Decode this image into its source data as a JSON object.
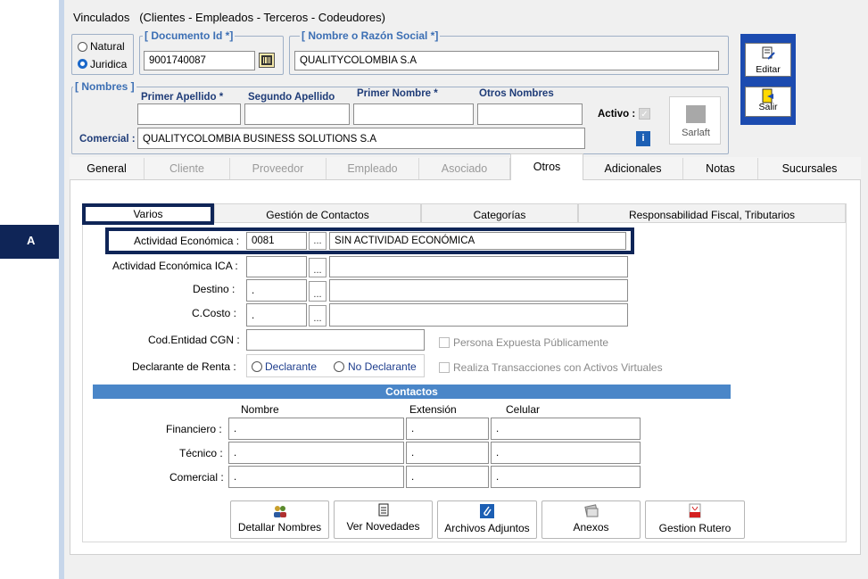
{
  "window": {
    "title": "Vinculados   (Clientes - Empleados - Terceros - Codeudores)"
  },
  "persona": {
    "natural_label": "Natural",
    "juridica_label": "Juridica",
    "selected": "Juridica"
  },
  "documento": {
    "legend": "[ Documento Id *]",
    "value": "9001740087"
  },
  "razon_social": {
    "legend": "[ Nombre o Razón Social *]",
    "value": "QUALITYCOLOMBIA S.A"
  },
  "nombres": {
    "legend": "[ Nombres ]",
    "primer_apellido": "Primer Apellido *",
    "segundo_apellido": "Segundo Apellido",
    "primer_nombre": "Primer Nombre *",
    "otros_nombres": "Otros Nombres",
    "activo_label": "Activo :",
    "comercial_label": "Comercial :",
    "comercial_value": "QUALITYCOLOMBIA BUSINESS SOLUTIONS S.A",
    "sarlaft_label": "Sarlaft"
  },
  "side_buttons": {
    "editar": "Editar",
    "salir": "Salir"
  },
  "tabs": [
    {
      "label": "General",
      "disabled": false
    },
    {
      "label": "Cliente",
      "disabled": true
    },
    {
      "label": "Proveedor",
      "disabled": true
    },
    {
      "label": "Empleado",
      "disabled": true
    },
    {
      "label": "Asociado",
      "disabled": true
    },
    {
      "label": "Otros",
      "disabled": false
    },
    {
      "label": "Adicionales",
      "disabled": false
    },
    {
      "label": "Notas",
      "disabled": false
    },
    {
      "label": "Sucursales",
      "disabled": false
    }
  ],
  "subtabs": [
    "Varios",
    "Gestión de Contactos",
    "Categorías",
    "Responsabilidad Fiscal, Tributarios"
  ],
  "callout": {
    "letter": "A"
  },
  "form": {
    "actividad_label": "Actividad Económica :",
    "actividad_code": "0081",
    "actividad_desc": "SIN ACTIVIDAD ECONÓMICA",
    "ica_label": "Actividad Económica ICA :",
    "destino_label": "Destino :",
    "destino_value": ".",
    "costo_label": "C.Costo :",
    "costo_value": ".",
    "cgn_label": "Cod.Entidad CGN :",
    "pep_label": "Persona Expuesta Públicamente",
    "renta_label": "Declarante de Renta :",
    "declarante": "Declarante",
    "no_declarante": "No Declarante",
    "virtuales_label": "Realiza Transacciones con Activos Virtuales",
    "dots": "..."
  },
  "contactos": {
    "title": "Contactos",
    "col_nombre": "Nombre",
    "col_extension": "Extensión",
    "col_celular": "Celular",
    "rows": [
      {
        "label": "Financiero :",
        "nombre": ".",
        "ext": ".",
        "cel": "."
      },
      {
        "label": "Técnico :",
        "nombre": ".",
        "ext": ".",
        "cel": "."
      },
      {
        "label": "Comercial :",
        "nombre": ".",
        "ext": ".",
        "cel": "."
      }
    ]
  },
  "actions": [
    "Detallar Nombres",
    "Ver Novedades",
    "Archivos Adjuntos",
    "Anexos",
    "Gestion Rutero"
  ],
  "colors": {
    "accent": "#1c4bb0",
    "highlight_box": "#0f2557",
    "contact_header": "#4a86c8",
    "legend": "#3c6fb4"
  }
}
